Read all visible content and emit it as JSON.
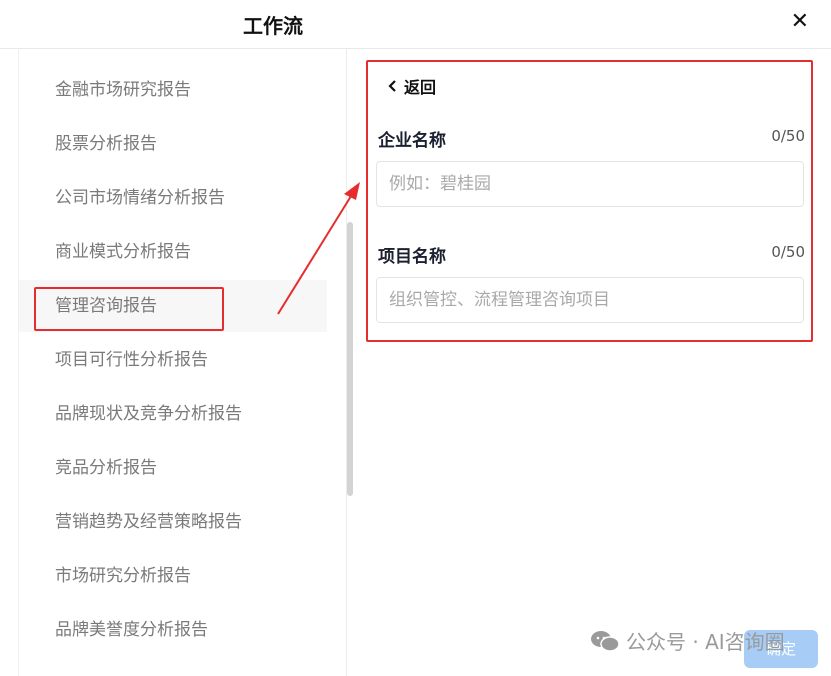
{
  "header": {
    "title": "工作流",
    "close_icon": "close-icon"
  },
  "sidebar": {
    "items": [
      {
        "label": "金融市场研究报告"
      },
      {
        "label": "股票分析报告"
      },
      {
        "label": "公司市场情绪分析报告"
      },
      {
        "label": "商业模式分析报告"
      },
      {
        "label": "管理咨询报告"
      },
      {
        "label": "项目可行性分析报告"
      },
      {
        "label": "品牌现状及竞争分析报告"
      },
      {
        "label": "竞品分析报告"
      },
      {
        "label": "营销趋势及经营策略报告"
      },
      {
        "label": "市场研究分析报告"
      },
      {
        "label": "品牌美誉度分析报告"
      }
    ],
    "active_index": 4
  },
  "form": {
    "back_label": "返回",
    "company": {
      "label": "企业名称",
      "count": "0/50",
      "placeholder": "例如：碧桂园"
    },
    "project": {
      "label": "项目名称",
      "count": "0/50",
      "placeholder": "组织管控、流程管理咨询项目"
    }
  },
  "footer": {
    "confirm_label": "确定"
  },
  "watermark": {
    "text": "公众号 · AI咨询圈"
  },
  "colors": {
    "annotation": "#e62d2d",
    "confirm_bg": "#a7cdf7"
  }
}
